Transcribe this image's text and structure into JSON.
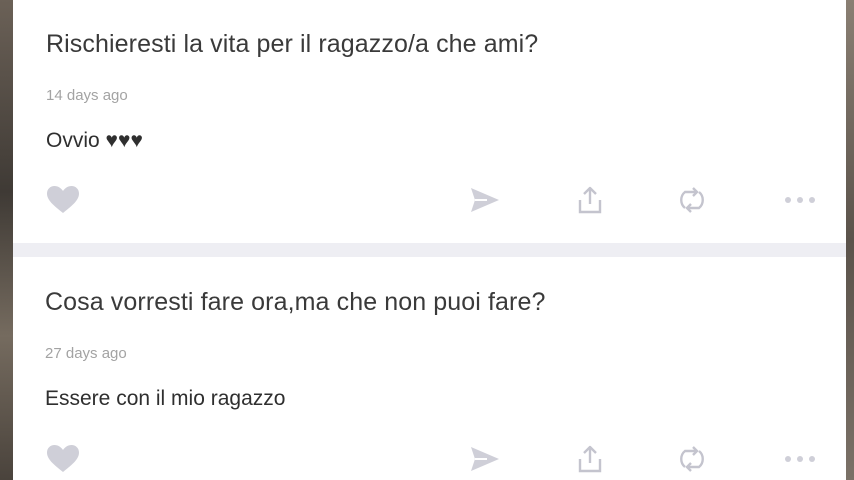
{
  "posts": [
    {
      "question": "Rischieresti la vita per il ragazzo/a che ami?",
      "time": "14 days ago",
      "answer": "Ovvio ♥♥♥"
    },
    {
      "question": "Cosa vorresti fare ora,ma che non puoi fare?",
      "time": "27 days ago",
      "answer": "Essere con il mio ragazzo"
    }
  ],
  "icons": {
    "like": "heart-icon",
    "send": "send-icon",
    "share": "share-icon",
    "reshare": "reshare-icon",
    "more": "more-icon"
  },
  "colors": {
    "icon": "#cfcfd8",
    "question": "#3a3a3a",
    "time": "#a3a3a3",
    "separator": "#eeeef3"
  }
}
